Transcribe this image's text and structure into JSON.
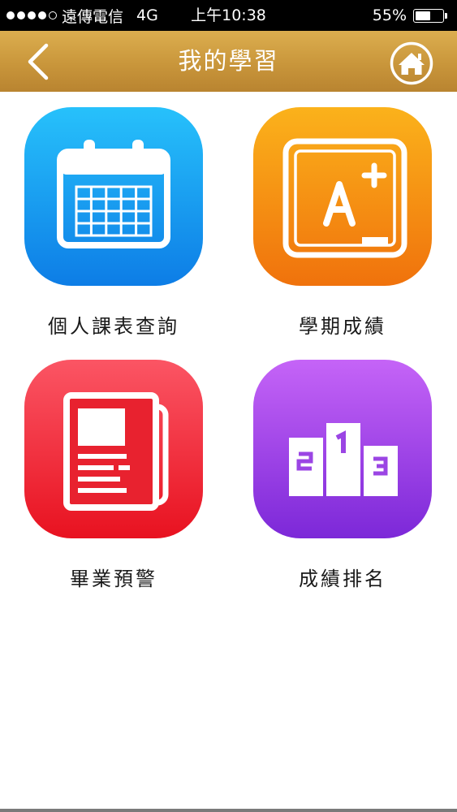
{
  "status_bar": {
    "carrier": "遠傳電信",
    "network": "4G",
    "time": "上午10:38",
    "battery_percent": "55%",
    "battery_level": 0.55,
    "signal_bars_filled": 4,
    "signal_bars_total": 5
  },
  "nav": {
    "title": "我的學習",
    "back_icon": "chevron-left-icon",
    "home_icon": "home-icon"
  },
  "menu": {
    "items": [
      {
        "label": "個人課表查詢",
        "icon": "calendar-icon",
        "color": "#1a9cf0"
      },
      {
        "label": "學期成績",
        "icon": "grade-board-icon",
        "color": "#f5880a"
      },
      {
        "label": "畢業預警",
        "icon": "newspaper-icon",
        "color": "#f5323d"
      },
      {
        "label": "成績排名",
        "icon": "podium-icon",
        "color": "#8f38e0"
      }
    ]
  },
  "colors": {
    "nav_gradient_top": "#dcae4f",
    "nav_gradient_bottom": "#b98430",
    "status_bar_bg": "#000000",
    "page_bg": "#ffffff"
  }
}
